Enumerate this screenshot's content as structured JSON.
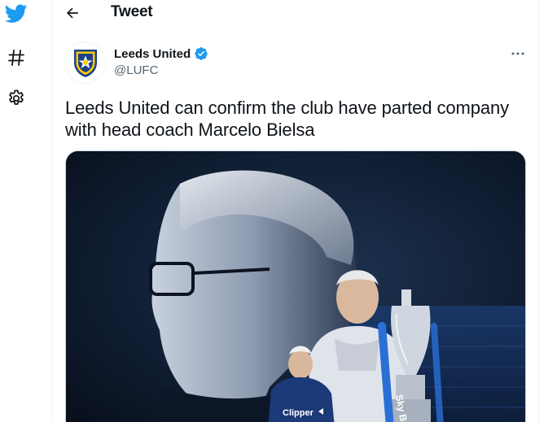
{
  "nav": {
    "logo_icon": "twitter-bird-icon",
    "explore_icon": "hashtag-icon",
    "settings_icon": "gear-icon",
    "accent_color": "#1d9bf0"
  },
  "header": {
    "back_icon": "arrow-left-icon",
    "title": "Tweet"
  },
  "tweet": {
    "author_name": "Leeds United",
    "author_handle": "@LUFC",
    "verified_icon": "verified-badge-icon",
    "verified_color": "#1d9bf0",
    "more_icon": "more-horizontal-icon",
    "text": "Leeds United can confirm the club have parted company with head coach Marcelo Bielsa",
    "media": {
      "kit_sponsor_text": "Clipper",
      "trophy_ribbon_text": "Sky Bet"
    }
  }
}
